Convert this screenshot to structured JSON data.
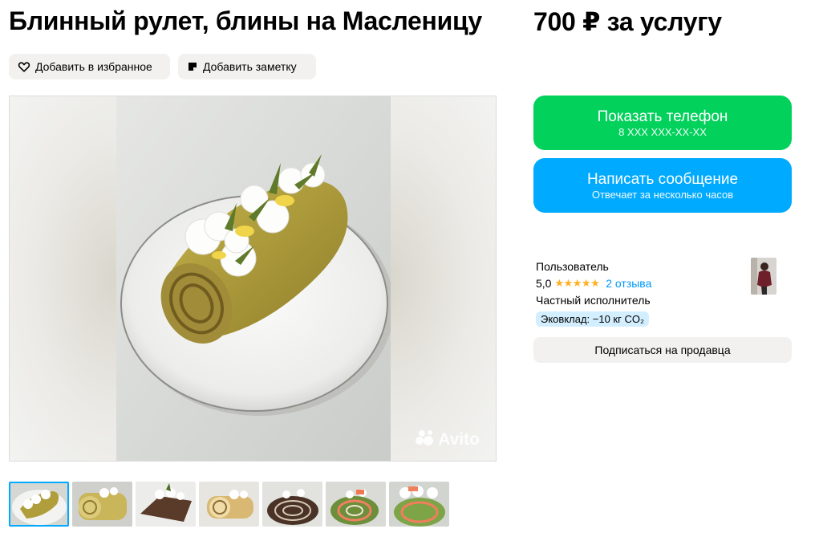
{
  "listing": {
    "title": "Блинный рулет, блины на Масленицу",
    "price": "700 ₽ за услугу"
  },
  "actions": {
    "favorite_label": "Добавить в избранное",
    "note_label": "Добавить заметку"
  },
  "gallery": {
    "watermark": "Avito",
    "thumbnail_count": 7,
    "active_thumbnail": 1
  },
  "contact": {
    "phone_label": "Показать телефон",
    "phone_masked": "8 XXX XXX-XX-XX",
    "message_label": "Написать сообщение",
    "message_sub": "Отвечает за несколько часов"
  },
  "seller": {
    "name": "Пользователь",
    "rating": "5,0",
    "stars": "★★★★★",
    "reviews": "2 отзыва",
    "type": "Частный исполнитель",
    "eco_badge": "Эковклад: −10 кг CO₂",
    "subscribe_label": "Подписаться на продавца"
  },
  "colors": {
    "phone_button": "#02d15c",
    "message_button": "#00aaff",
    "link": "#0099f7",
    "star": "#ffb021",
    "chip_bg": "#f2f1f0"
  },
  "icons": {
    "favorite": "heart-icon",
    "note": "note-icon",
    "watermark": "avito-logo-icon"
  }
}
